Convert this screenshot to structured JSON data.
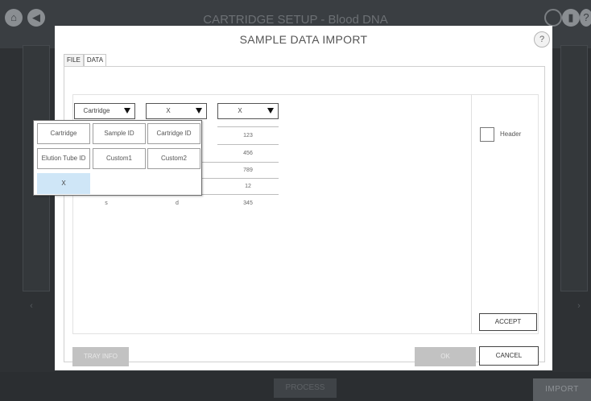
{
  "background": {
    "title": "CARTRIDGE SETUP - Blood DNA",
    "buttons": {
      "bottom_center": "PROCESS",
      "import": "IMPORT"
    }
  },
  "dialog": {
    "title": "SAMPLE DATA IMPORT",
    "help": "?",
    "tabs": [
      "FILE",
      "DATA"
    ],
    "column_selectors": [
      "Cartridge",
      "X",
      "X"
    ],
    "rows": [
      [
        "",
        "",
        "123"
      ],
      [
        "",
        "",
        "456"
      ],
      [
        "",
        "",
        "789"
      ],
      [
        "",
        "",
        "12"
      ],
      [
        "s",
        "d",
        "345"
      ]
    ],
    "header_checkbox": {
      "label": "Header",
      "checked": false
    },
    "accept": "ACCEPT",
    "tray_info": "TRAY INFO",
    "ok": "OK",
    "cancel": "CANCEL"
  },
  "dropdown": {
    "options": [
      "Cartridge",
      "Sample ID",
      "Cartridge ID",
      "Elution Tube ID",
      "Custom1",
      "Custom2",
      "X"
    ],
    "selected": "X"
  },
  "colors": {
    "backdrop": "#2e3134",
    "dialog": "#ffffff",
    "disabled_button": "#c2c2c2",
    "selected_option": "#cfe6f7"
  }
}
